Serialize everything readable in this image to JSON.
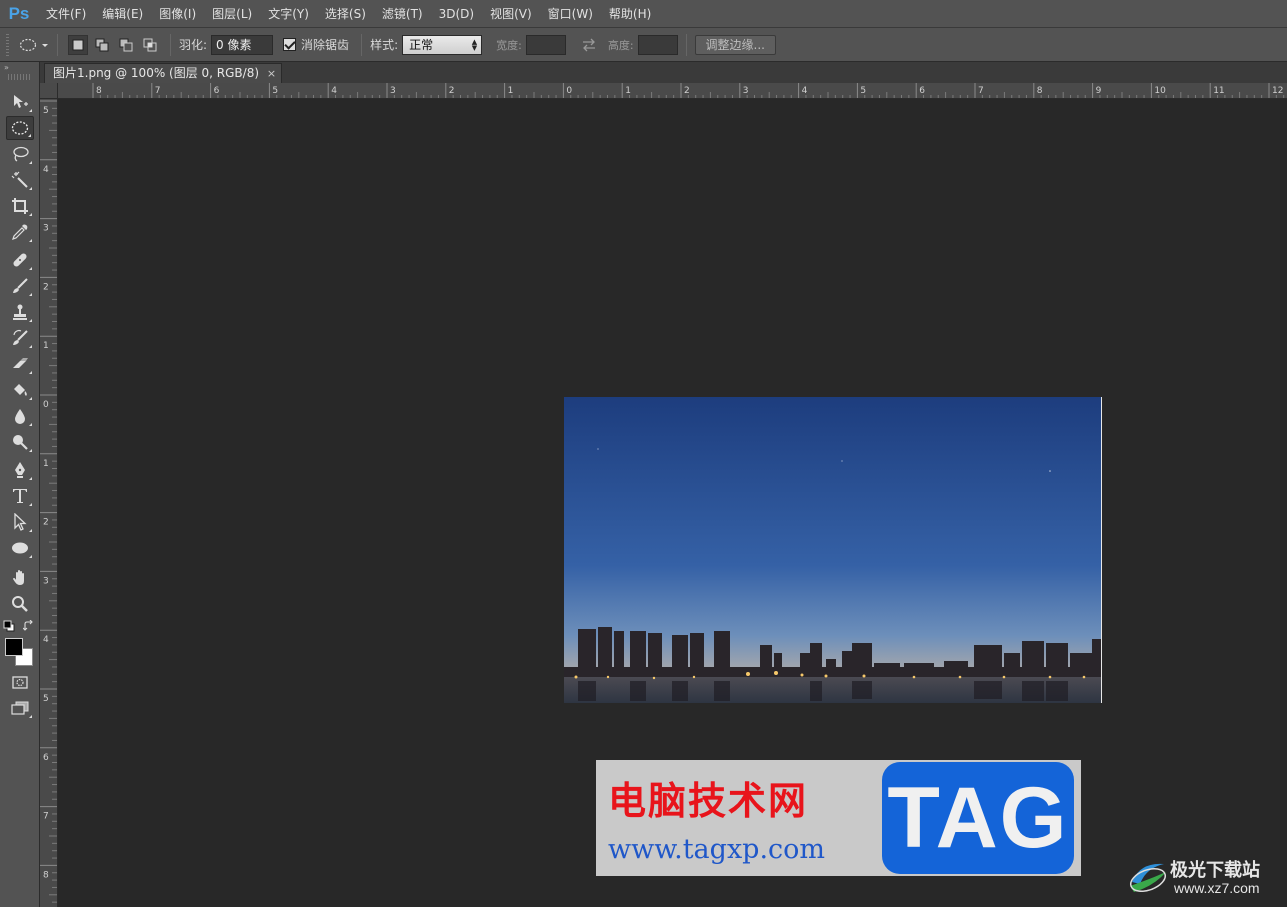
{
  "app": {
    "logo": "Ps"
  },
  "menu": [
    "文件(F)",
    "编辑(E)",
    "图像(I)",
    "图层(L)",
    "文字(Y)",
    "选择(S)",
    "滤镜(T)",
    "3D(D)",
    "视图(V)",
    "窗口(W)",
    "帮助(H)"
  ],
  "options_bar": {
    "feather_label": "羽化:",
    "feather_value": "0 像素",
    "antialias_label": "消除锯齿",
    "antialias_checked": true,
    "style_label": "样式:",
    "style_value": "正常",
    "width_label": "宽度:",
    "height_label": "高度:",
    "refine_edge_label": "调整边缘..."
  },
  "document_tab": {
    "title": "图片1.png @ 100% (图层 0, RGB/8)",
    "close": "×"
  },
  "toolbar": {
    "header": "»",
    "tools": [
      {
        "name": "move-tool",
        "icon": "move-icon"
      },
      {
        "name": "elliptical-marquee-tool",
        "icon": "ellipse-marquee-icon",
        "active": true
      },
      {
        "name": "lasso-tool",
        "icon": "lasso-icon"
      },
      {
        "name": "magic-wand-tool",
        "icon": "magic-wand-icon"
      },
      {
        "name": "crop-tool",
        "icon": "crop-icon"
      },
      {
        "name": "eyedropper-tool",
        "icon": "eyedropper-icon"
      },
      {
        "name": "healing-brush-tool",
        "icon": "bandage-icon"
      },
      {
        "name": "brush-tool",
        "icon": "brush-icon"
      },
      {
        "name": "clone-stamp-tool",
        "icon": "stamp-icon"
      },
      {
        "name": "history-brush-tool",
        "icon": "history-brush-icon"
      },
      {
        "name": "eraser-tool",
        "icon": "eraser-icon"
      },
      {
        "name": "paint-bucket-tool",
        "icon": "bucket-icon"
      },
      {
        "name": "blur-tool",
        "icon": "drop-icon"
      },
      {
        "name": "dodge-tool",
        "icon": "dodge-icon"
      },
      {
        "name": "pen-tool",
        "icon": "pen-icon"
      },
      {
        "name": "type-tool",
        "icon": "type-icon"
      },
      {
        "name": "path-selection-tool",
        "icon": "arrow-icon"
      },
      {
        "name": "ellipse-shape-tool",
        "icon": "ellipse-icon"
      },
      {
        "name": "hand-tool",
        "icon": "hand-icon"
      },
      {
        "name": "zoom-tool",
        "icon": "zoom-icon"
      }
    ],
    "foreground_color": "#000000",
    "background_color": "#ffffff"
  },
  "rulers": {
    "top_labels": [
      "8",
      "7",
      "6",
      "5",
      "4",
      "3",
      "2",
      "1",
      "0",
      "1",
      "2",
      "3",
      "4",
      "5",
      "6",
      "7",
      "8",
      "9",
      "10",
      "11",
      "12"
    ],
    "left_labels": [
      "5",
      "4",
      "3",
      "2",
      "1",
      "0",
      "1",
      "2",
      "3",
      "4",
      "5",
      "6",
      "7",
      "8"
    ]
  },
  "watermark": {
    "site_name": "电脑技术网",
    "site_url": "www.tagxp.com",
    "tag": "TAG",
    "corner_name": "极光下载站",
    "corner_url": "www.xz7.com"
  },
  "colors": {
    "sky_top": "#1d3d7e",
    "sky_bottom": "#b89a80",
    "watermark_red": "#e8141b",
    "watermark_blue": "#1464d8"
  }
}
